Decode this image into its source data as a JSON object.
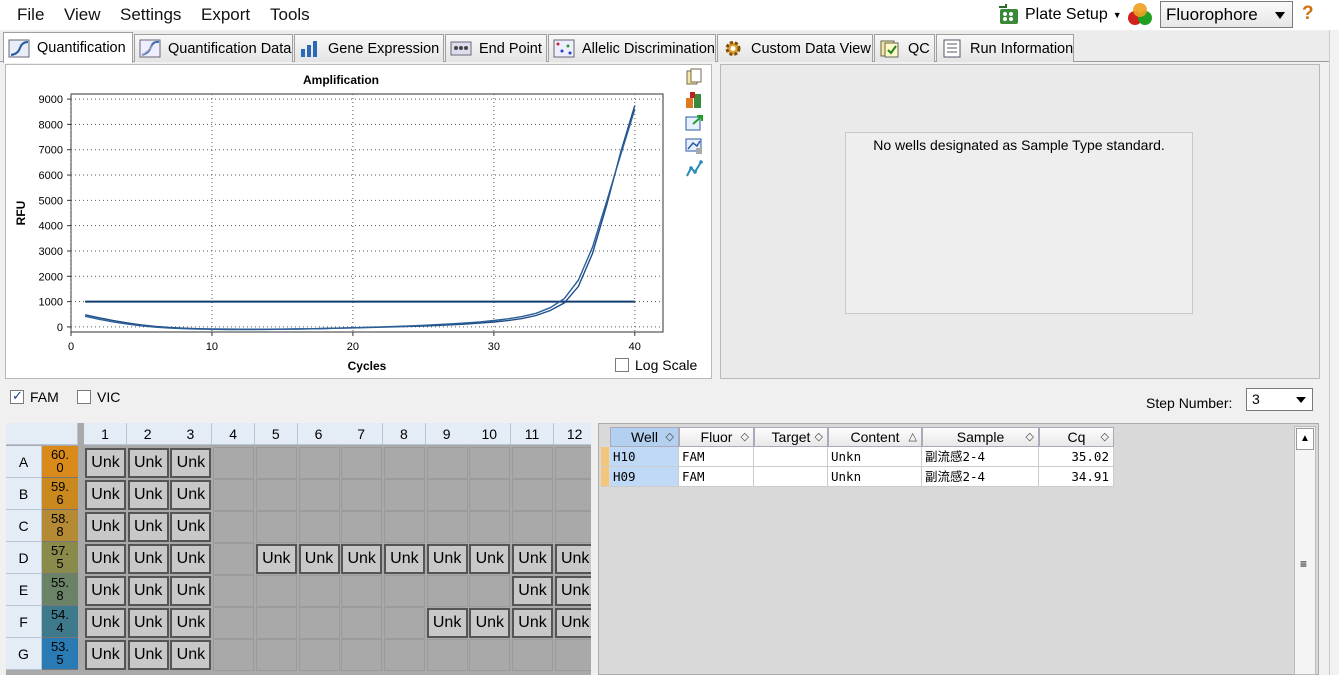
{
  "menu": {
    "file": "File",
    "view": "View",
    "settings": "Settings",
    "export": "Export",
    "tools": "Tools"
  },
  "toolbar": {
    "plate_setup": "Plate Setup",
    "fluor_select": "Fluorophore",
    "help": "?"
  },
  "tabs": [
    {
      "label": "Quantification",
      "icon": "amplification-icon"
    },
    {
      "label": "Quantification Data",
      "icon": "quant-data-icon"
    },
    {
      "label": "Gene Expression",
      "icon": "bar-chart-icon"
    },
    {
      "label": "End Point",
      "icon": "endpoint-icon"
    },
    {
      "label": "Allelic Discrimination",
      "icon": "scatter-icon"
    },
    {
      "label": "Custom Data View",
      "icon": "gear-icon"
    },
    {
      "label": "QC",
      "icon": "qc-icon"
    },
    {
      "label": "Run Information",
      "icon": "document-icon"
    }
  ],
  "chart_data": {
    "type": "line",
    "title": "Amplification",
    "xlabel": "Cycles",
    "ylabel": "RFU",
    "xlim": [
      0,
      42
    ],
    "ylim": [
      -200,
      9200
    ],
    "xticks": [
      0,
      10,
      20,
      30,
      40
    ],
    "yticks": [
      0,
      1000,
      2000,
      3000,
      4000,
      5000,
      6000,
      7000,
      8000,
      9000
    ],
    "grid": true,
    "threshold": 1000,
    "series": [
      {
        "x": [
          1,
          2,
          3,
          4,
          5,
          6,
          7,
          8,
          9,
          10,
          11,
          12,
          13,
          14,
          15,
          16,
          17,
          18,
          19,
          20,
          21,
          22,
          23,
          24,
          25,
          26,
          27,
          28,
          29,
          30,
          31,
          32,
          33,
          34,
          35,
          36,
          37,
          38,
          39,
          40
        ],
        "values": [
          480,
          360,
          250,
          160,
          80,
          20,
          -20,
          -50,
          -70,
          -80,
          -85,
          -90,
          -90,
          -88,
          -85,
          -80,
          -72,
          -62,
          -50,
          -38,
          -25,
          -10,
          5,
          20,
          38,
          60,
          85,
          115,
          150,
          195,
          250,
          330,
          450,
          650,
          950,
          1600,
          2900,
          4800,
          6900,
          8750
        ]
      },
      {
        "x": [
          1,
          2,
          3,
          4,
          5,
          6,
          7,
          8,
          9,
          10,
          11,
          12,
          13,
          14,
          15,
          16,
          17,
          18,
          19,
          20,
          21,
          22,
          23,
          24,
          25,
          26,
          27,
          28,
          29,
          30,
          31,
          32,
          33,
          34,
          35,
          36,
          37,
          38,
          39,
          40
        ],
        "values": [
          420,
          300,
          200,
          115,
          45,
          -10,
          -45,
          -70,
          -85,
          -95,
          -100,
          -102,
          -100,
          -96,
          -90,
          -82,
          -72,
          -60,
          -46,
          -30,
          -14,
          3,
          22,
          42,
          65,
          92,
          122,
          158,
          200,
          255,
          320,
          410,
          540,
          760,
          1120,
          1850,
          3150,
          4950,
          6800,
          8600
        ]
      }
    ]
  },
  "chart": {
    "log_scale_label": "Log Scale",
    "tool_icons": [
      "copy-icon",
      "export-excel-icon",
      "export-image-icon",
      "chart-settings-icon",
      "trace-style-icon"
    ]
  },
  "standard_curve": {
    "message": "No wells designated as Sample Type standard."
  },
  "fluor_toggles": [
    {
      "label": "FAM",
      "checked": true
    },
    {
      "label": "VIC",
      "checked": false
    }
  ],
  "step": {
    "label": "Step Number:",
    "value": "3"
  },
  "plate": {
    "col_labels": [
      "1",
      "2",
      "3",
      "4",
      "5",
      "6",
      "7",
      "8",
      "9",
      "10",
      "11",
      "12"
    ],
    "rows": [
      {
        "label": "A",
        "temp": "60.\n0",
        "temp_color": "#d98a1a",
        "wells": [
          "Unk",
          "Unk",
          "Unk",
          "",
          "",
          "",
          "",
          "",
          "",
          "",
          "",
          ""
        ]
      },
      {
        "label": "B",
        "temp": "59.\n6",
        "temp_color": "#c9891e",
        "wells": [
          "Unk",
          "Unk",
          "Unk",
          "",
          "",
          "",
          "",
          "",
          "",
          "",
          "",
          ""
        ]
      },
      {
        "label": "C",
        "temp": "58.\n8",
        "temp_color": "#b58a34",
        "wells": [
          "Unk",
          "Unk",
          "Unk",
          "",
          "",
          "",
          "",
          "",
          "",
          "",
          "",
          ""
        ]
      },
      {
        "label": "D",
        "temp": "57.\n5",
        "temp_color": "#8a8a4a",
        "wells": [
          "Unk",
          "Unk",
          "Unk",
          "",
          "Unk",
          "Unk",
          "Unk",
          "Unk",
          "Unk",
          "Unk",
          "Unk",
          "Unk"
        ]
      },
      {
        "label": "E",
        "temp": "55.\n8",
        "temp_color": "#6a8266",
        "wells": [
          "Unk",
          "Unk",
          "Unk",
          "",
          "",
          "",
          "",
          "",
          "",
          "",
          "Unk",
          "Unk"
        ]
      },
      {
        "label": "F",
        "temp": "54.\n4",
        "temp_color": "#3f7a8c",
        "wells": [
          "Unk",
          "Unk",
          "Unk",
          "",
          "",
          "",
          "",
          "",
          "Unk",
          "Unk",
          "Unk",
          "Unk"
        ]
      },
      {
        "label": "G",
        "temp": "53.\n5",
        "temp_color": "#2a7ab4",
        "wells": [
          "Unk",
          "Unk",
          "Unk",
          "",
          "",
          "",
          "",
          "",
          "",
          "",
          "",
          ""
        ]
      }
    ]
  },
  "results_table": {
    "headers": [
      "Well",
      "Fluor",
      "Target",
      "Content",
      "Sample",
      "Cq"
    ],
    "rows": [
      [
        "H10",
        "FAM",
        "",
        "Unkn",
        "副流感2-4",
        "35.02"
      ],
      [
        "H09",
        "FAM",
        "",
        "Unkn",
        "副流感2-4",
        "34.91"
      ]
    ]
  }
}
